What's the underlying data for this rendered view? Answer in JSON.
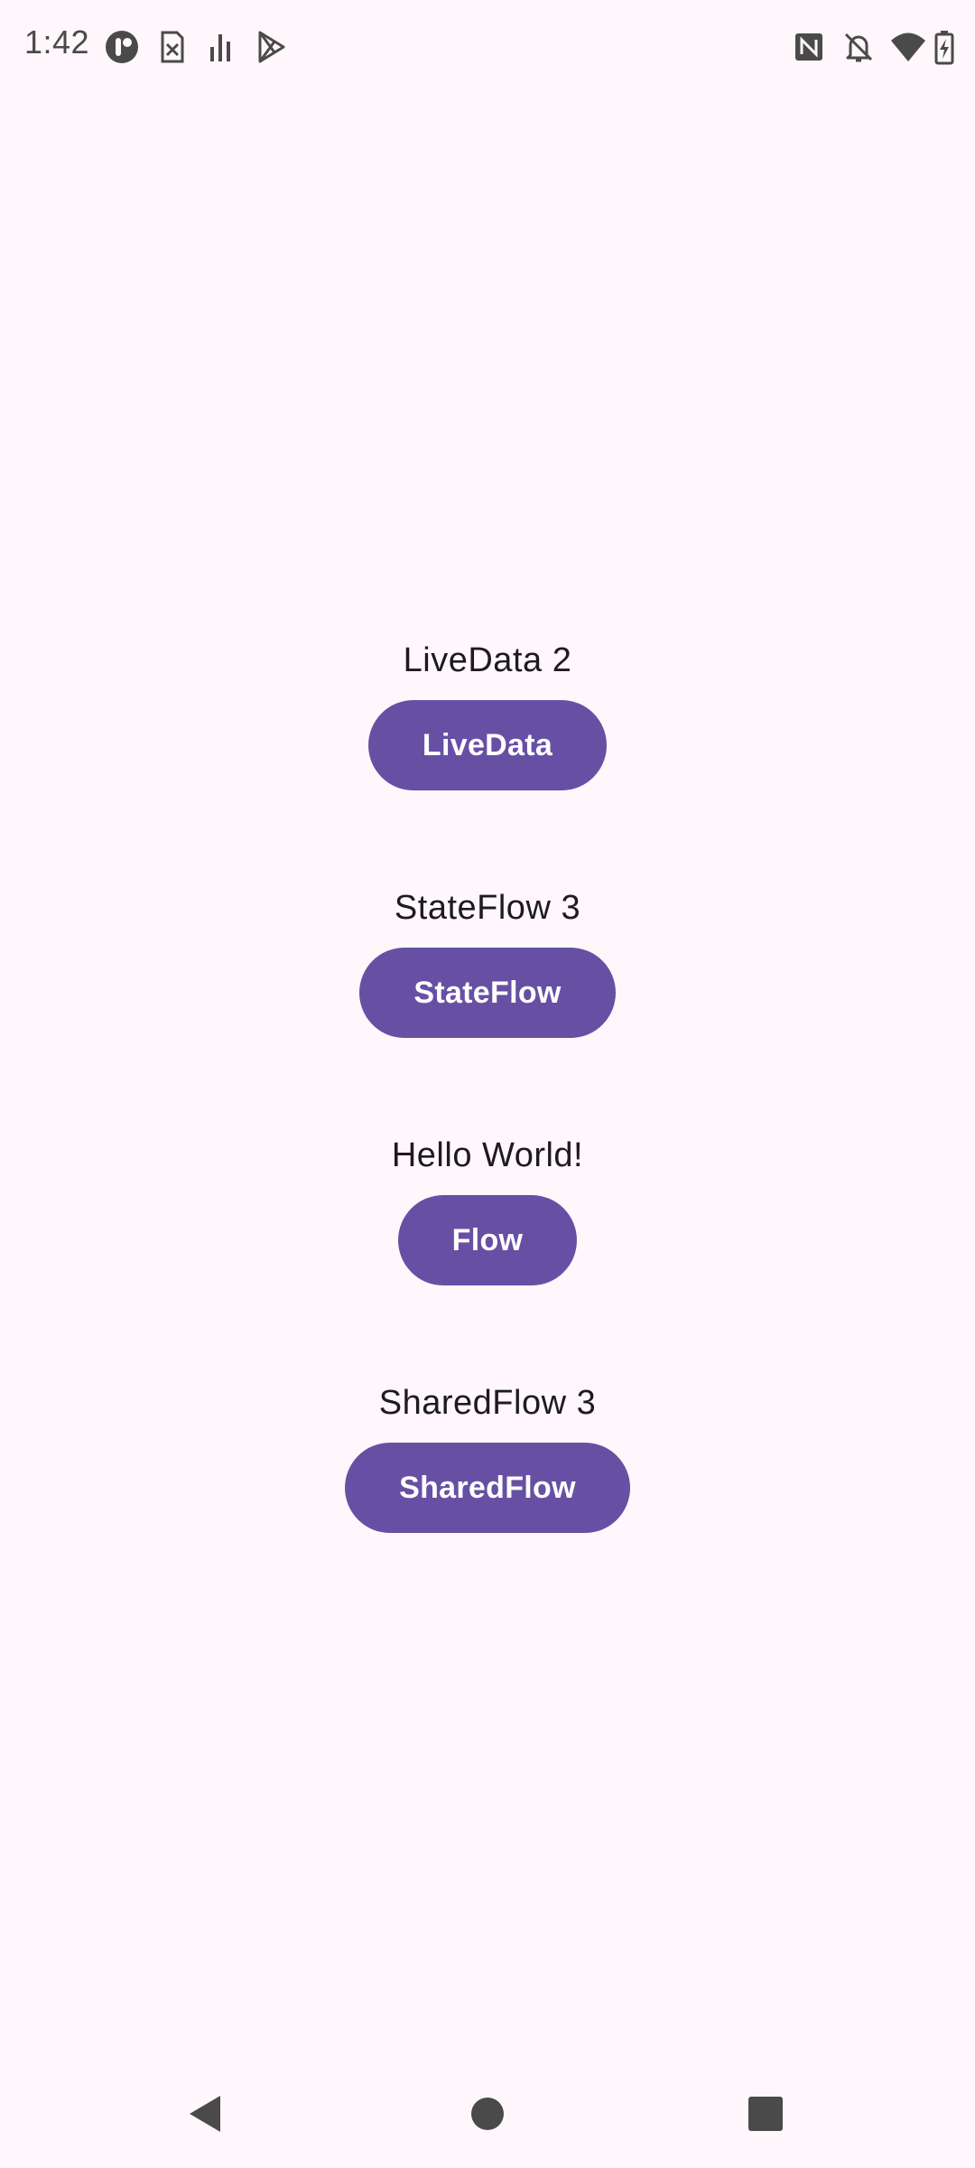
{
  "status_bar": {
    "time": "1:42",
    "icons_left": [
      "app-indicator-icon",
      "sim-card-x-icon",
      "signal-bars-icon",
      "play-store-icon"
    ],
    "icons_right": [
      "nfc-icon",
      "notifications-off-icon",
      "wifi-icon",
      "battery-charging-icon"
    ],
    "icon_color": "#4A4A4A"
  },
  "main": {
    "items": [
      {
        "label": "LiveData 2",
        "button": "LiveData"
      },
      {
        "label": "StateFlow 3",
        "button": "StateFlow"
      },
      {
        "label": "Hello World!",
        "button": "Flow"
      },
      {
        "label": "SharedFlow 3",
        "button": "SharedFlow"
      }
    ]
  },
  "nav_bar": {
    "buttons": [
      "back-icon",
      "home-icon",
      "recents-icon"
    ]
  },
  "colors": {
    "background": "#FFF7FC",
    "primary": "#6750A4",
    "on_primary": "#FFFFFF",
    "text": "#1D1B20"
  }
}
